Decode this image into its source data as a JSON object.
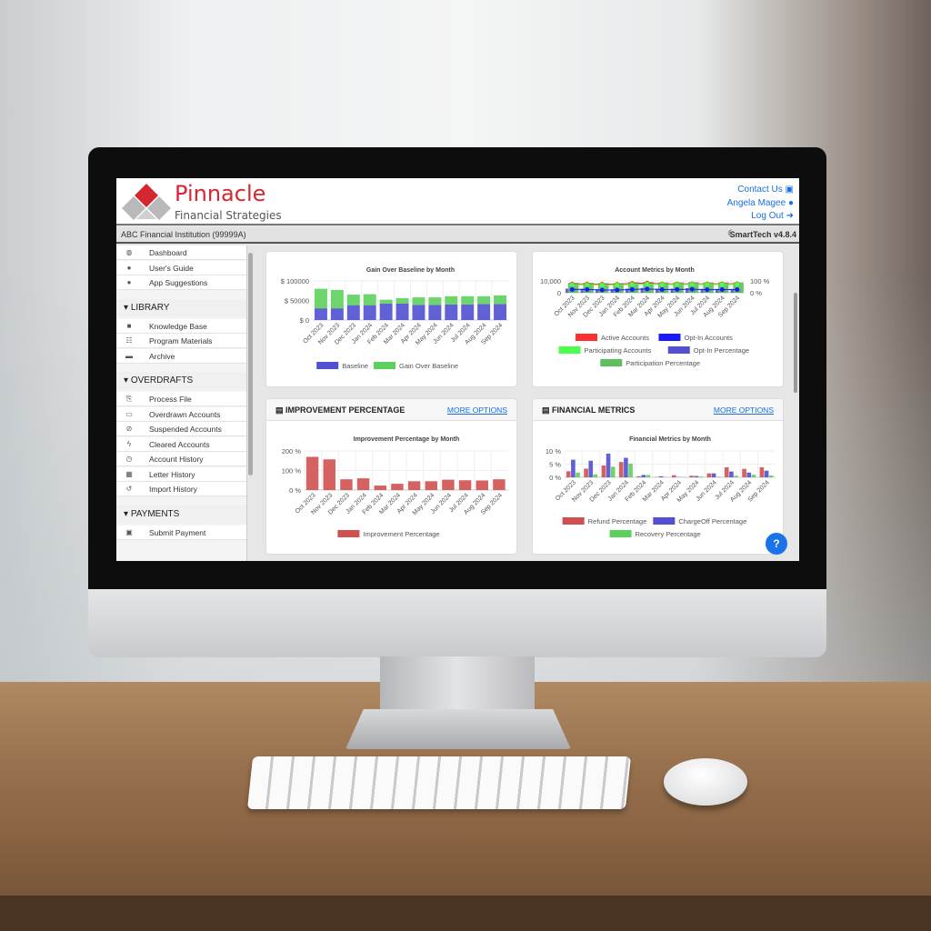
{
  "header": {
    "brand": "Pinnacle",
    "brand_sub": "Financial Strategies",
    "contact_us": "Contact Us",
    "user_name": "Angela Magee",
    "log_out": "Log Out",
    "brand_color": "#d6262f",
    "link_color": "#1a6fe0"
  },
  "info_bar": {
    "institution": "ABC Financial Institution (99999A)",
    "version": "SmartTech v4.8.4",
    "theme_icon": "moon-icon"
  },
  "sidebar": {
    "top_items": [
      {
        "label": "Dashboard",
        "icon": "dashboard-icon"
      },
      {
        "label": "User's Guide",
        "icon": "info-icon"
      },
      {
        "label": "App Suggestions",
        "icon": "comment-icon"
      }
    ],
    "sections": [
      {
        "title": "LIBRARY",
        "items": [
          {
            "label": "Knowledge Base",
            "icon": "folder-icon"
          },
          {
            "label": "Program Materials",
            "icon": "sitemap-icon"
          },
          {
            "label": "Archive",
            "icon": "archive-icon"
          }
        ]
      },
      {
        "title": "OVERDRAFTS",
        "items": [
          {
            "label": "Process File",
            "icon": "file-import-icon"
          },
          {
            "label": "Overdrawn Accounts",
            "icon": "credit-card-icon"
          },
          {
            "label": "Suspended Accounts",
            "icon": "ban-icon"
          },
          {
            "label": "Cleared Accounts",
            "icon": "bolt-icon"
          },
          {
            "label": "Account History",
            "icon": "clock-icon"
          },
          {
            "label": "Letter History",
            "icon": "calendar-icon"
          },
          {
            "label": "Import History",
            "icon": "history-icon"
          }
        ]
      },
      {
        "title": "PAYMENTS",
        "items": [
          {
            "label": "Submit Payment",
            "icon": "money-icon"
          }
        ]
      }
    ]
  },
  "cards": [
    {
      "heading": "",
      "more": ""
    },
    {
      "heading": "",
      "more": ""
    },
    {
      "heading": "IMPROVEMENT PERCENTAGE",
      "more": "MORE OPTIONS",
      "icon": "chart-bar-icon"
    },
    {
      "heading": "FINANCIAL METRICS",
      "more": "MORE OPTIONS",
      "icon": "chart-bar-icon"
    }
  ],
  "help_button": "?",
  "chart_data": [
    {
      "type": "bar",
      "stacked": true,
      "title": "Gain Over Baseline by Month",
      "categories": [
        "Oct 2023",
        "Nov 2023",
        "Dec 2023",
        "Jan 2024",
        "Feb 2024",
        "Mar 2024",
        "Apr 2024",
        "May 2024",
        "Jun 2024",
        "Jul 2024",
        "Aug 2024",
        "Sep 2024"
      ],
      "ylim": [
        0,
        100000
      ],
      "yticks": [
        "$ 0",
        "$ 50000",
        "$ 100000"
      ],
      "grid": true,
      "legend": "bottom",
      "series": [
        {
          "name": "Baseline",
          "color": "#5050d0",
          "values": [
            30000,
            30000,
            38000,
            38000,
            42000,
            42000,
            39000,
            39000,
            40000,
            40000,
            41000,
            41000
          ]
        },
        {
          "name": "Gain Over Baseline",
          "color": "#5cd05c",
          "values": [
            50000,
            47000,
            27000,
            28000,
            10000,
            14000,
            19000,
            19000,
            21000,
            21000,
            20000,
            22000
          ]
        }
      ]
    },
    {
      "type": "bar+line",
      "title": "Account Metrics by Month",
      "categories": [
        "Oct 2023",
        "Nov 2023",
        "Dec 2023",
        "Jan 2024",
        "Feb 2024",
        "Mar 2024",
        "Apr 2024",
        "May 2024",
        "Jun 2024",
        "Jul 2024",
        "Aug 2024",
        "Sep 2024"
      ],
      "ylim": [
        0,
        10000
      ],
      "yticks": [
        "0",
        "10,000"
      ],
      "y2lim": [
        0,
        100
      ],
      "y2ticks": [
        "0 %",
        "100 %"
      ],
      "grid": true,
      "legend": "bottom",
      "series": [
        {
          "name": "Active Accounts",
          "kind": "line",
          "axis": "left",
          "color": "#ff3030",
          "values": [
            7500,
            7500,
            7300,
            7200,
            8000,
            8200,
            7500,
            7500,
            7600,
            7500,
            7600,
            7600
          ]
        },
        {
          "name": "Opt-In Accounts",
          "kind": "line",
          "axis": "left",
          "color": "#1a1aff",
          "values": [
            2800,
            2800,
            2300,
            2300,
            2800,
            3200,
            2700,
            2800,
            3000,
            2600,
            2700,
            2700
          ]
        },
        {
          "name": "Participating Accounts",
          "kind": "line",
          "axis": "left",
          "color": "#4cff4c",
          "values": [
            6800,
            6800,
            6600,
            6600,
            7200,
            7400,
            7000,
            7000,
            7100,
            7000,
            7100,
            7100
          ]
        },
        {
          "name": "Opt-In Percentage",
          "kind": "bar",
          "axis": "right",
          "color": "#5050d0",
          "values": [
            35,
            35,
            30,
            30,
            35,
            40,
            35,
            35,
            38,
            33,
            33,
            33
          ]
        },
        {
          "name": "Participation Percentage",
          "kind": "bar",
          "axis": "right",
          "color": "#5cc05c",
          "values": [
            85,
            85,
            82,
            82,
            90,
            92,
            88,
            88,
            90,
            88,
            88,
            88
          ]
        }
      ]
    },
    {
      "type": "bar",
      "title": "Improvement Percentage by Month",
      "categories": [
        "Oct 2023",
        "Nov 2023",
        "Dec 2023",
        "Jan 2024",
        "Feb 2024",
        "Mar 2024",
        "Apr 2024",
        "May 2024",
        "Jun 2024",
        "Jul 2024",
        "Aug 2024",
        "Sep 2024"
      ],
      "ylim": [
        0,
        200
      ],
      "yticks": [
        "0 %",
        "100 %",
        "200 %"
      ],
      "grid": true,
      "legend": "bottom",
      "series": [
        {
          "name": "Improvement Percentage",
          "color": "#d05050",
          "values": [
            170,
            157,
            55,
            60,
            23,
            32,
            45,
            45,
            53,
            50,
            49,
            55
          ]
        }
      ]
    },
    {
      "type": "bar",
      "title": "Financial Metrics by Month",
      "categories": [
        "Oct 2023",
        "Nov 2023",
        "Dec 2023",
        "Jan 2024",
        "Feb 2024",
        "Mar 2024",
        "Apr 2024",
        "May 2024",
        "Jun 2024",
        "Jul 2024",
        "Aug 2024",
        "Sep 2024"
      ],
      "ylim": [
        0,
        10
      ],
      "yticks": [
        "0 %",
        "5 %",
        "10 %"
      ],
      "grid": true,
      "legend": "bottom",
      "series": [
        {
          "name": "Refund Percentage",
          "color": "#d05050",
          "values": [
            2.3,
            3.3,
            4.5,
            5.8,
            0.4,
            0.1,
            0.8,
            0.6,
            1.5,
            3.8,
            3.2,
            3.8
          ]
        },
        {
          "name": "ChargeOff Percentage",
          "color": "#5050d0",
          "values": [
            6.7,
            6.3,
            9.0,
            7.4,
            0.9,
            0.4,
            0.1,
            0.5,
            1.5,
            2.2,
            1.8,
            2.5
          ]
        },
        {
          "name": "Recovery Percentage",
          "color": "#5cd05c",
          "values": [
            1.8,
            1.1,
            4.0,
            5.2,
            0.9,
            0.1,
            0.1,
            0.3,
            0.2,
            0.6,
            1.0,
            0.7
          ]
        }
      ]
    }
  ]
}
